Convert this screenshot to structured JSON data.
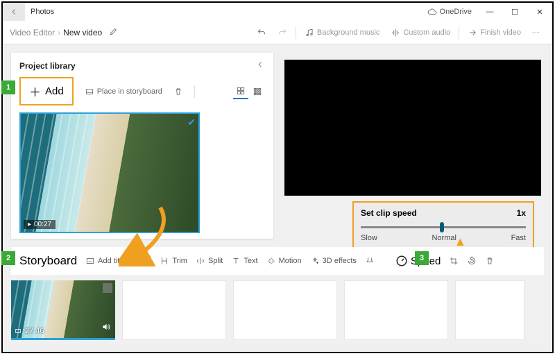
{
  "titlebar": {
    "app_name": "Photos",
    "onedrive": "OneDrive"
  },
  "breadcrumb": {
    "root": "Video Editor",
    "current": "New video"
  },
  "topright": {
    "bg_music": "Background music",
    "custom_audio": "Custom audio",
    "finish": "Finish video"
  },
  "library": {
    "title": "Project library",
    "add": "Add",
    "place": "Place in storyboard",
    "thumb_duration": "00:27"
  },
  "speed_popup": {
    "title": "Set clip speed",
    "multiplier": "1x",
    "slow": "Slow",
    "normal": "Normal",
    "fast": "Fast"
  },
  "storyboard": {
    "title": "Storyboard",
    "add_title": "Add title card",
    "trim": "Trim",
    "split": "Split",
    "text": "Text",
    "motion": "Motion",
    "effects": "3D effects",
    "speed": "Speed",
    "clip_duration": "27.46"
  }
}
